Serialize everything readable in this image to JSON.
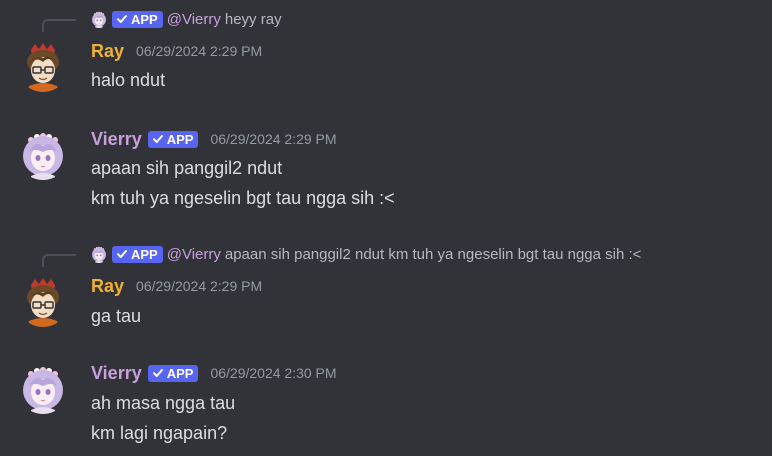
{
  "colors": {
    "background": "#313338",
    "ray_name": "#f0b232",
    "vierry_name": "#c9a0dc",
    "app_badge": "#5865f2",
    "text": "#dbdee1",
    "muted": "#949ba4"
  },
  "icons": {
    "verified_check": "check-icon",
    "reply_spine": "reply-connector"
  },
  "messages": [
    {
      "reply": {
        "badge": "APP",
        "author": "@Vierry",
        "text": "heyy ray"
      },
      "author": "Ray",
      "timestamp": "06/29/2024 2:29 PM",
      "lines": [
        "halo ndut"
      ]
    },
    {
      "author": "Vierry",
      "badge": "APP",
      "timestamp": "06/29/2024 2:29 PM",
      "lines": [
        "apaan sih panggil2 ndut",
        "km tuh ya ngeselin bgt tau ngga sih :<"
      ]
    },
    {
      "reply": {
        "badge": "APP",
        "author": "@Vierry",
        "text": "apaan sih panggil2 ndut km tuh ya ngeselin bgt tau ngga sih :<"
      },
      "author": "Ray",
      "timestamp": "06/29/2024 2:29 PM",
      "lines": [
        "ga tau"
      ]
    },
    {
      "author": "Vierry",
      "badge": "APP",
      "timestamp": "06/29/2024 2:30 PM",
      "lines": [
        "ah masa ngga tau",
        "km lagi ngapain?"
      ]
    }
  ]
}
